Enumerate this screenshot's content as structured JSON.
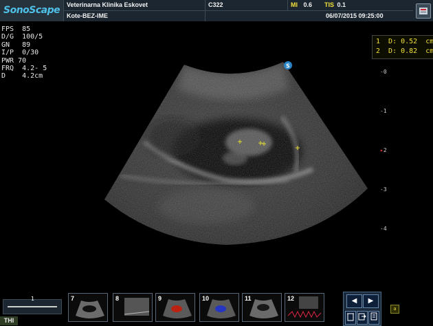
{
  "header": {
    "brand": "SonoScape",
    "clinic": "Veterinarna Klinika Eskovet",
    "patient": "Kote-BEZ-IME",
    "probe": "C322",
    "mi_label": "MI",
    "mi_value": "0.6",
    "tis_label": "TIS",
    "tis_value": "0.1",
    "datetime": "06/07/2015 09:25:00"
  },
  "params": [
    "FPS  85",
    "D/G  100/5",
    "GN   89",
    "I/P  0/30",
    "PWR 70",
    "FRQ  4.2- 5",
    "D    4.2cm"
  ],
  "measurements": [
    "1  D: 0.52  cm",
    "2  D: 0.82  cm"
  ],
  "depth_scale": [
    "0",
    "1",
    "2",
    "3",
    "4"
  ],
  "slider_value": "1",
  "mode_label": "THI",
  "thumbnails": [
    "7",
    "8",
    "9",
    "10",
    "11",
    "12"
  ],
  "nav": {
    "prev": "◀",
    "next": "▶"
  },
  "small_box_label": "a",
  "colors": {
    "header_bg": "#1c2630",
    "brand": "#4fc1e9",
    "measure": "#f2e23a",
    "focus_marker": "#e33"
  }
}
